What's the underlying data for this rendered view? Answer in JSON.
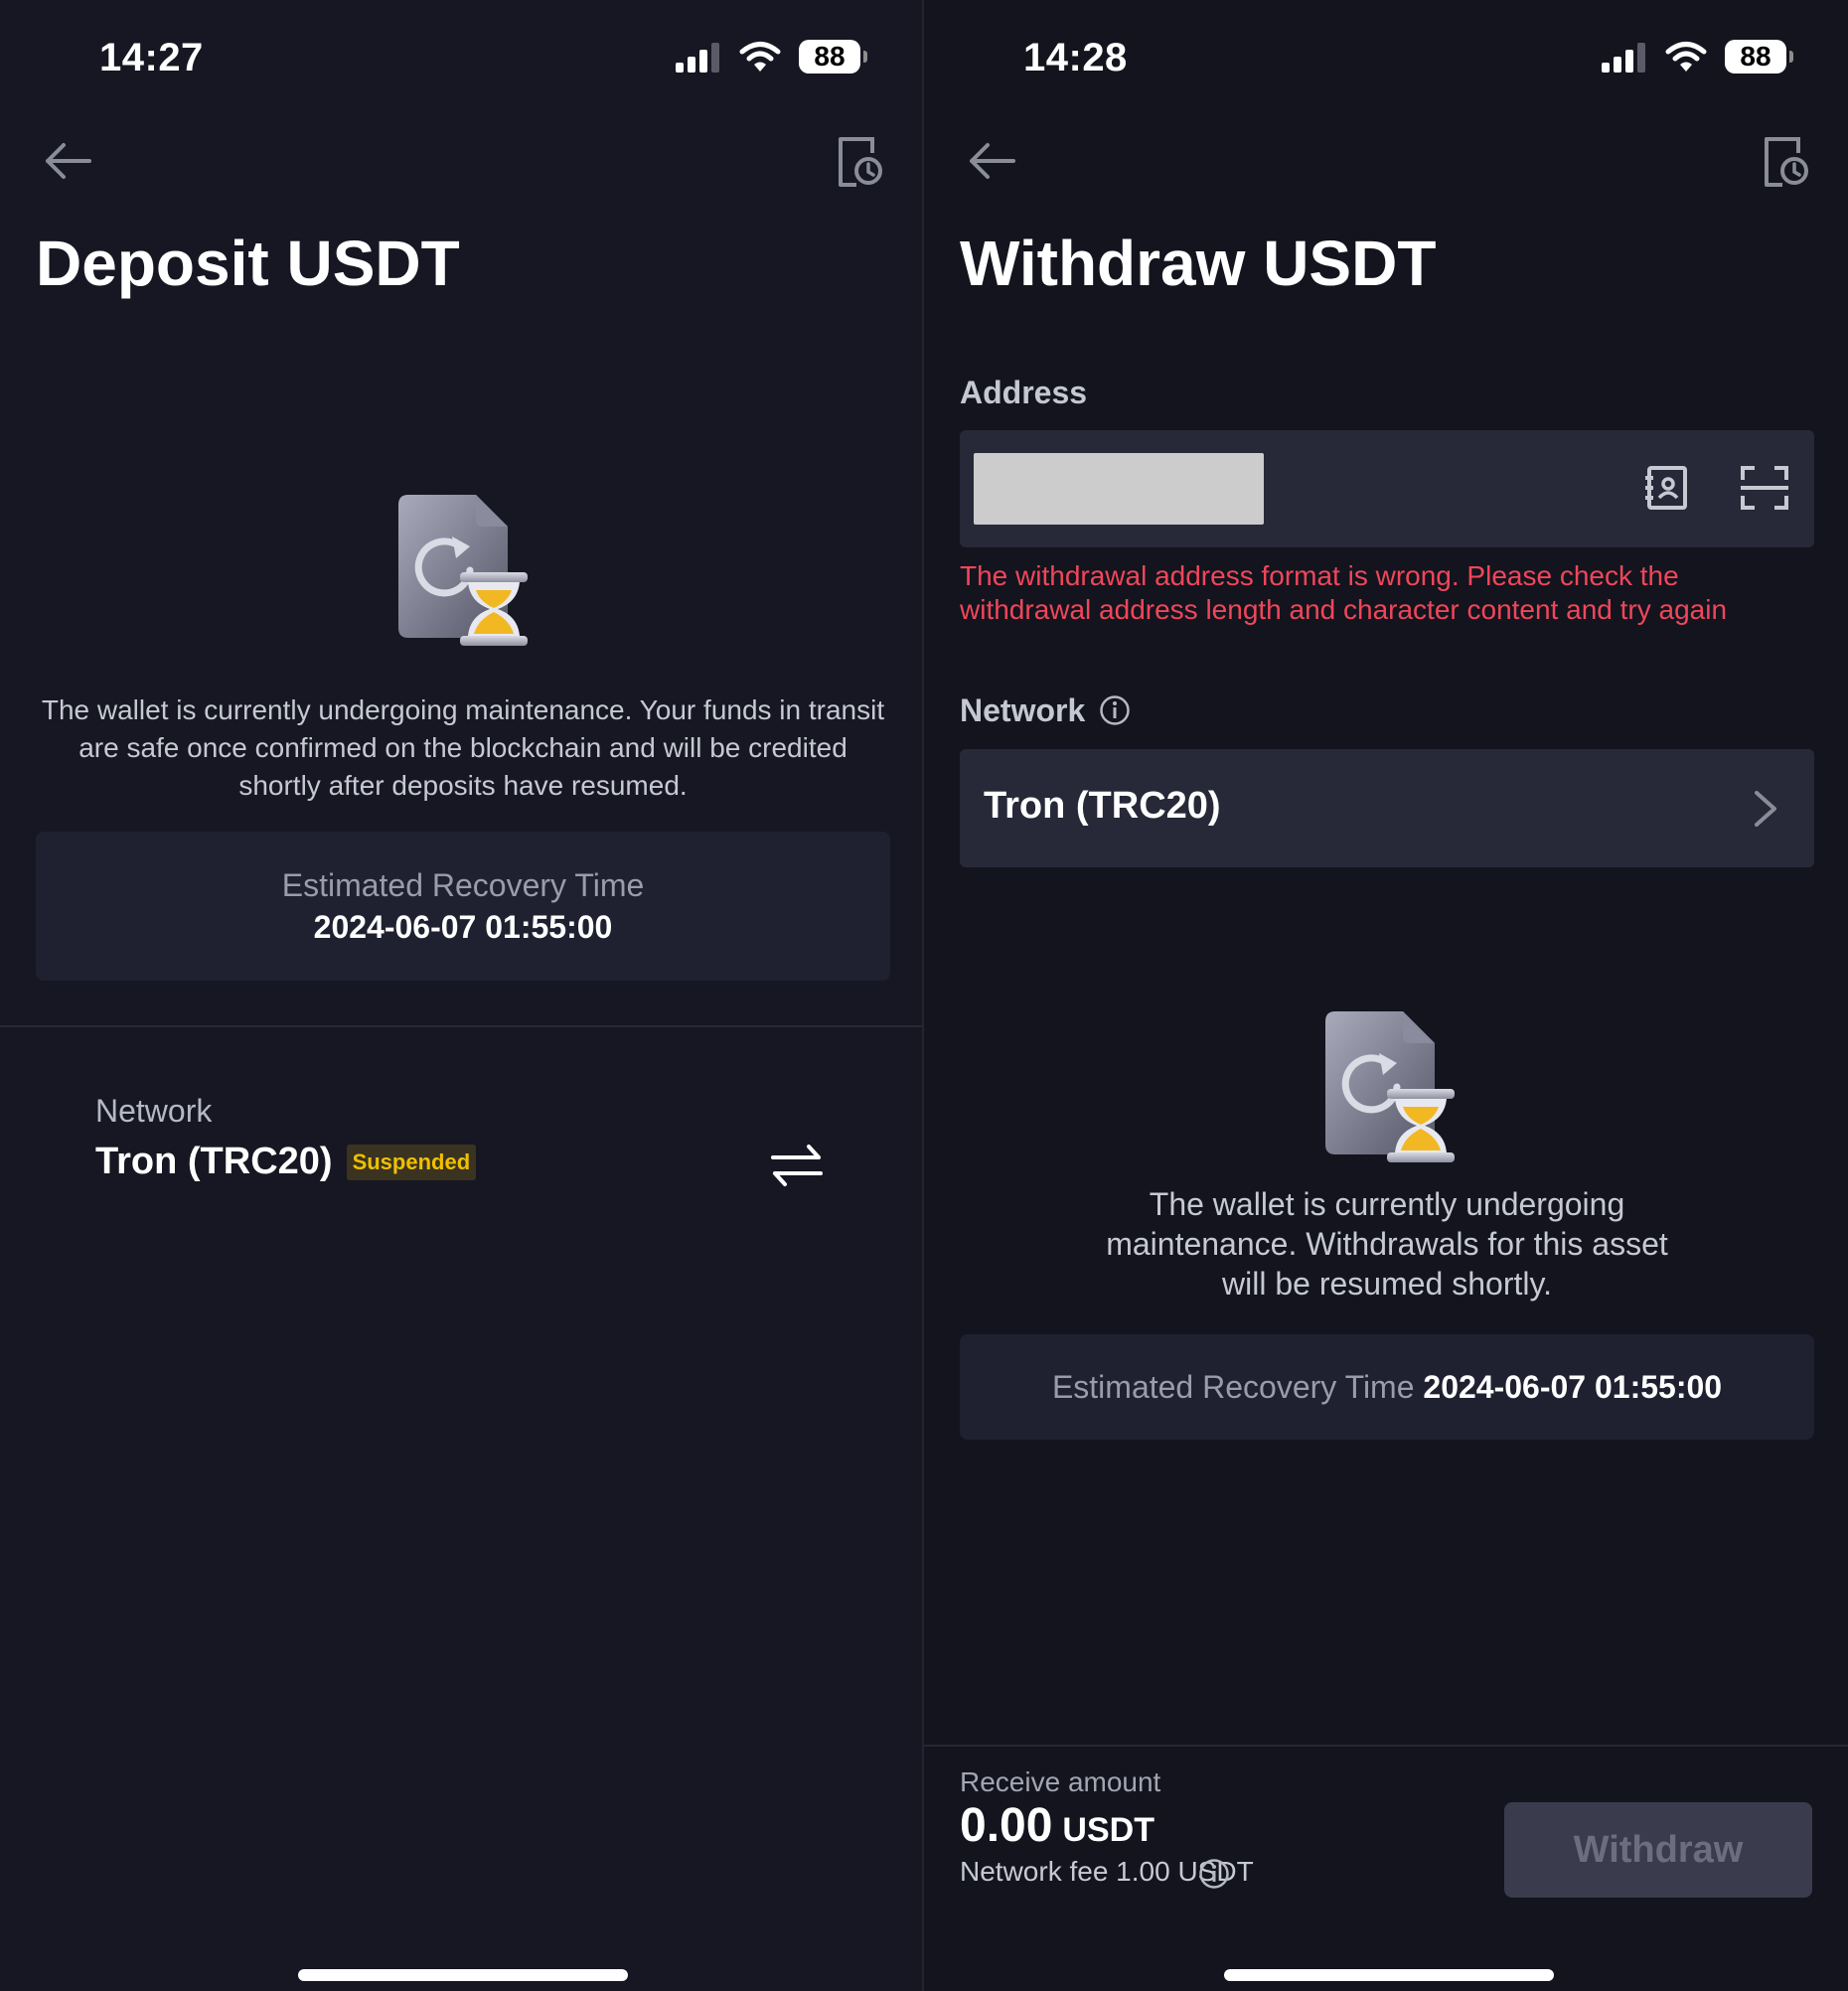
{
  "deposit": {
    "status_bar": {
      "time": "14:27",
      "battery": "88"
    },
    "title": "Deposit USDT",
    "maintenance_text": "The wallet is currently undergoing maintenance. Your funds in transit are safe once confirmed on the blockchain and will be credited shortly after deposits have resumed.",
    "recovery": {
      "label": "Estimated Recovery Time",
      "value": "2024-06-07 01:55:00"
    },
    "network": {
      "label": "Network",
      "value": "Tron (TRC20)",
      "badge": "Suspended"
    }
  },
  "withdraw": {
    "status_bar": {
      "time": "14:28",
      "battery": "88"
    },
    "title": "Withdraw USDT",
    "address": {
      "label": "Address",
      "value": "",
      "error": "The withdrawal address format is wrong. Please check the withdrawal address length and character content and try again"
    },
    "network": {
      "label": "Network",
      "value": "Tron (TRC20)"
    },
    "maintenance_text": "The wallet is currently undergoing maintenance. Withdrawals for this asset will be resumed shortly.",
    "recovery": {
      "label": "Estimated Recovery Time",
      "value": "2024-06-07 01:55:00"
    },
    "footer": {
      "receive_label": "Receive amount",
      "amount": "0.00",
      "unit": "USDT",
      "fee": "Network fee 1.00 USDT",
      "button": "Withdraw"
    }
  },
  "colors": {
    "background": "#161722",
    "card": "#272938",
    "error": "#f0465a",
    "badge": "#f0c000",
    "illustration_accent": "#f2b824"
  }
}
